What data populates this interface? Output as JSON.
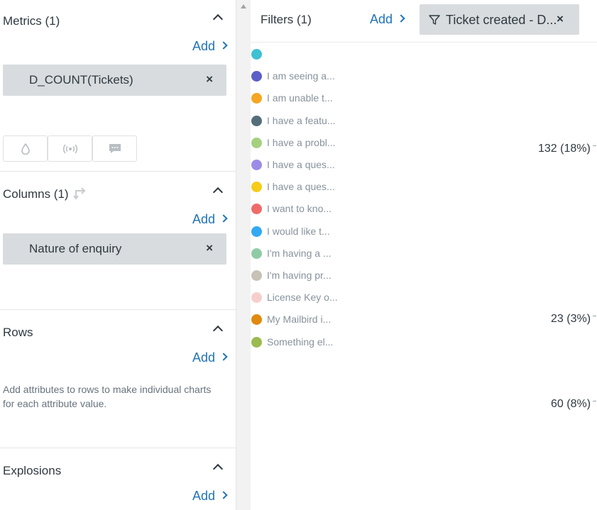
{
  "sidebar": {
    "metrics": {
      "title": "Metrics (1)",
      "add_label": "Add",
      "pill_label": "D_COUNT(Tickets)",
      "remove_glyph": "×",
      "buttons": [
        {
          "icon": "drop-icon"
        },
        {
          "icon": "broadcast-icon"
        },
        {
          "icon": "chat-bubble-icon"
        }
      ]
    },
    "columns": {
      "title": "Columns (1)",
      "add_label": "Add",
      "pill_label": "Nature of enquiry",
      "remove_glyph": "×"
    },
    "rows": {
      "title": "Rows",
      "add_label": "Add",
      "hint": "Add attributes to rows to make individual charts for each attribute value."
    },
    "explosions": {
      "title": "Explosions",
      "add_label": "Add"
    }
  },
  "filters": {
    "title": "Filters (1)",
    "add_label": "Add",
    "chip_label": "Ticket created - D...",
    "remove_glyph": "×"
  },
  "legend": [
    {
      "label": "",
      "color": "#3ec1d3"
    },
    {
      "label": "I am seeing a...",
      "color": "#5b5fc7"
    },
    {
      "label": "I am unable t...",
      "color": "#f5a623"
    },
    {
      "label": "I have a featu...",
      "color": "#546e7a"
    },
    {
      "label": "I have a probl...",
      "color": "#a5d17e"
    },
    {
      "label": "I have a ques...",
      "color": "#9c8ce8"
    },
    {
      "label": "I have a ques...",
      "color": "#f5cc1a"
    },
    {
      "label": "I want to kno...",
      "color": "#ef6b6b"
    },
    {
      "label": "I would like t...",
      "color": "#33a9f2"
    },
    {
      "label": "I'm having a ...",
      "color": "#8fcca6"
    },
    {
      "label": "I'm having pr...",
      "color": "#c7c2b5"
    },
    {
      "label": "License Key o...",
      "color": "#f6cfcc"
    },
    {
      "label": "My Mailbird i...",
      "color": "#e08a10"
    },
    {
      "label": "Something el...",
      "color": "#9bbb4e"
    }
  ],
  "values": [
    {
      "label": "132 (18%)"
    },
    {
      "label": "23 (3%)"
    },
    {
      "label": "60 (8%)"
    }
  ]
}
